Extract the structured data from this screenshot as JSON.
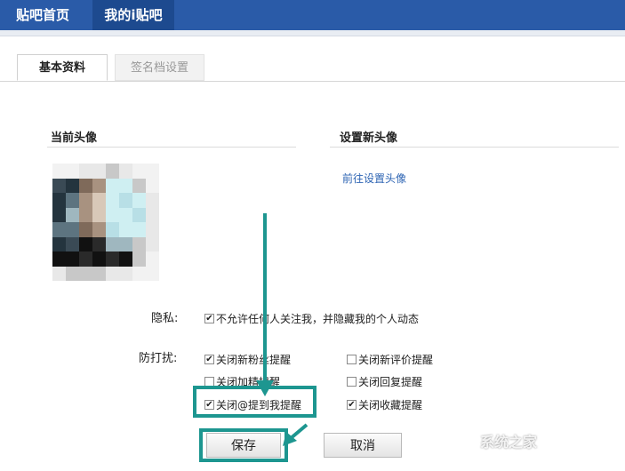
{
  "topnav": {
    "home": "贴吧首页",
    "mine": "我的i贴吧"
  },
  "profile_tabs": {
    "basic": "基本资料",
    "signature": "签名档设置"
  },
  "current_avatar": {
    "title": "当前头像"
  },
  "new_avatar": {
    "title": "设置新头像",
    "link": "前往设置头像"
  },
  "privacy": {
    "label": "隐私:",
    "option": {
      "text": "不允许任何人关注我，并隐藏我的个人动态",
      "checked": true
    }
  },
  "disturb": {
    "label": "防打扰:",
    "left": [
      {
        "text": "关闭新粉丝提醒",
        "checked": true
      },
      {
        "text": "关闭加精提醒",
        "checked": false
      },
      {
        "text": "关闭@提到我提醒",
        "checked": true
      }
    ],
    "right": [
      {
        "text": "关闭新评价提醒",
        "checked": false
      },
      {
        "text": "关闭回复提醒",
        "checked": false
      },
      {
        "text": "关闭收藏提醒",
        "checked": true
      }
    ]
  },
  "actions": {
    "save": "保存",
    "cancel": "取消"
  },
  "watermark": "系统之家",
  "colors": {
    "nav": "#2a5ba8",
    "highlight": "#1d9690",
    "link": "#2d64b3"
  }
}
